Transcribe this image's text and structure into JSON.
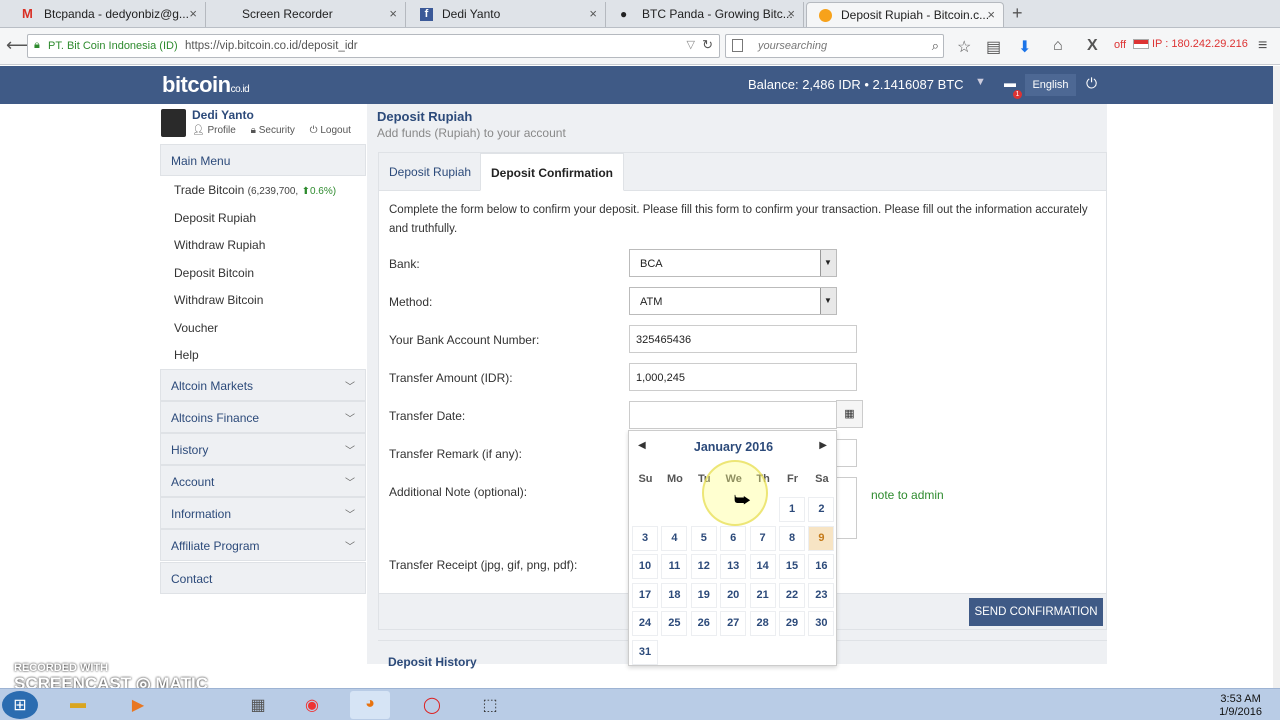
{
  "browser": {
    "tabs": [
      {
        "label": "Btcpanda - dedyonbiz@g..."
      },
      {
        "label": "Screen Recorder"
      },
      {
        "label": "Dedi Yanto"
      },
      {
        "label": "BTC Panda - Growing Bitc..."
      },
      {
        "label": "Deposit Rupiah - Bitcoin.c..."
      }
    ],
    "site_identity": "PT. Bit Coin Indonesia (ID)",
    "url": "https://vip.bitcoin.co.id/deposit_idr",
    "search_placeholder": "yoursearching",
    "proxy_status": "off",
    "ip_text": "IP : 180.242.29.216"
  },
  "site": {
    "logo": "bitcoin",
    "logo_suffix": "co.id",
    "balance_text": "Balance: 2,486 IDR • 2.1416087 BTC",
    "language": "English",
    "notif_count": "1"
  },
  "user": {
    "name": "Dedi Yanto",
    "profile": "Profile",
    "security": "Security",
    "logout": "Logout"
  },
  "sidebar": {
    "main_menu": "Main Menu",
    "items": [
      {
        "label": "Trade Bitcoin",
        "extra": "(6,239,700,",
        "change": "0.6%)"
      },
      {
        "label": "Deposit Rupiah"
      },
      {
        "label": "Withdraw Rupiah"
      },
      {
        "label": "Deposit Bitcoin"
      },
      {
        "label": "Withdraw Bitcoin"
      },
      {
        "label": "Voucher"
      },
      {
        "label": "Help"
      }
    ],
    "accordions": [
      {
        "label": "Altcoin Markets"
      },
      {
        "label": "Altcoins Finance"
      },
      {
        "label": "History"
      },
      {
        "label": "Account"
      },
      {
        "label": "Information"
      },
      {
        "label": "Affiliate Program"
      },
      {
        "label": "Contact"
      }
    ]
  },
  "page": {
    "title": "Deposit Rupiah",
    "subtitle": "Add funds (Rupiah) to your account",
    "tab_deposit": "Deposit Rupiah",
    "tab_confirm": "Deposit Confirmation",
    "intro": "Complete the form below to confirm your deposit. Please fill this form to confirm your transaction. Please fill out the information accurately and truthfully.",
    "labels": {
      "bank": "Bank:",
      "method": "Method:",
      "account": "Your Bank Account Number:",
      "amount": "Transfer Amount (IDR):",
      "date": "Transfer Date:",
      "remark": "Transfer Remark (if any):",
      "note": "Additional Note (optional):",
      "receipt": "Transfer Receipt (jpg, gif, png, pdf):"
    },
    "values": {
      "bank": "BCA",
      "method": "ATM",
      "account": "325465436",
      "amount": "1,000,245"
    },
    "note_hint": "note to admin",
    "send_button": "SEND CONFIRMATION",
    "history_title": "Deposit History"
  },
  "datepicker": {
    "month": "January 2016",
    "dow": [
      "Su",
      "Mo",
      "Tu",
      "We",
      "Th",
      "Fr",
      "Sa"
    ],
    "today": "9",
    "first_weekday": 5,
    "days": [
      "1",
      "2",
      "3",
      "4",
      "5",
      "6",
      "7",
      "8",
      "9",
      "10",
      "11",
      "12",
      "13",
      "14",
      "15",
      "16",
      "17",
      "18",
      "19",
      "20",
      "21",
      "22",
      "23",
      "24",
      "25",
      "26",
      "27",
      "28",
      "29",
      "30",
      "31"
    ]
  },
  "watermark": {
    "line1": "RECORDED WITH",
    "line2": "SCREENCAST",
    "line3": "MATIC"
  },
  "taskbar": {
    "time": "3:53 AM",
    "date": "1/9/2016"
  }
}
